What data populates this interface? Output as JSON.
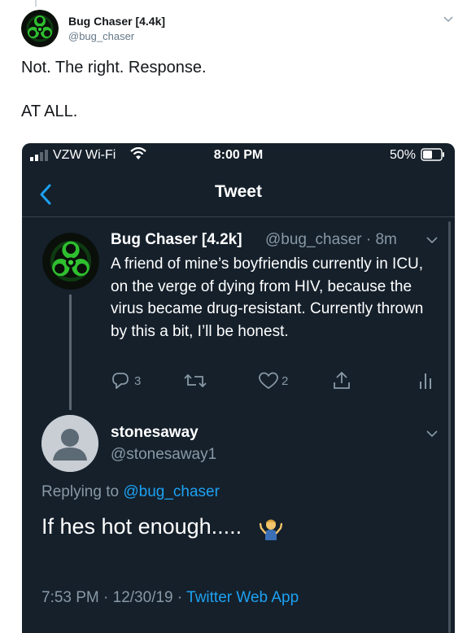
{
  "outer_tweet": {
    "author_name": "Bug Chaser [4.4k]",
    "author_handle": "@bug_chaser",
    "text": "Not. The right. Response.\n\nAT ALL."
  },
  "screenshot": {
    "status_bar": {
      "carrier": "VZW Wi-Fi",
      "time": "8:00 PM",
      "battery": "50%"
    },
    "header_title": "Tweet",
    "original_tweet": {
      "author_name": "Bug Chaser [4.2k]",
      "author_handle": "@bug_chaser",
      "time_ago": "· 8m",
      "text": "A friend of mine’s boyfriendis currently in ICU, on the verge of dying from HIV, because the virus became drug-resistant. Currently thrown by this a bit, I’ll be honest.",
      "reply_count": "3",
      "like_count": "2"
    },
    "reply": {
      "author_name": "stonesaway",
      "author_handle": "@stonesaway1",
      "replying_label": "Replying to",
      "replying_to": "@bug_chaser",
      "text": "If hes hot enough.....",
      "timestamp": "7:53 PM · 12/30/19 · ",
      "source": "Twitter Web App"
    }
  },
  "colors": {
    "dark_bg": "#15202b",
    "accent": "#1da1f2",
    "muted": "#8899a6",
    "avatar_green": "#3ad43a"
  },
  "icons": [
    "biohazard-avatar-icon",
    "chevron-down-icon",
    "signal-icon",
    "wifi-icon",
    "battery-icon",
    "back-chevron-icon",
    "reply-icon",
    "retweet-icon",
    "like-icon",
    "share-icon",
    "analytics-icon",
    "default-avatar-icon",
    "shrug-emoji-icon"
  ]
}
